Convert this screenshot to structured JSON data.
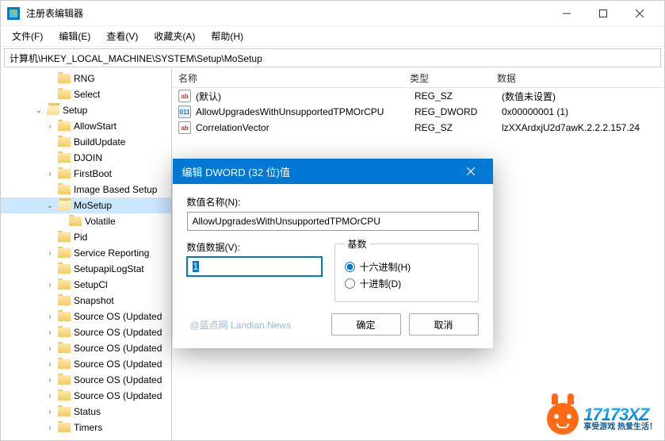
{
  "window": {
    "title": "注册表编辑器"
  },
  "menu": {
    "file": "文件(F)",
    "edit": "编辑(E)",
    "view": "查看(V)",
    "favorites": "收藏夹(A)",
    "help": "帮助(H)"
  },
  "address": "计算机\\HKEY_LOCAL_MACHINE\\SYSTEM\\Setup\\MoSetup",
  "tree": {
    "items": [
      {
        "indent": 4,
        "twisty": "",
        "open": false,
        "label": "RNG"
      },
      {
        "indent": 4,
        "twisty": "",
        "open": false,
        "label": "Select"
      },
      {
        "indent": 3,
        "twisty": "v",
        "open": true,
        "label": "Setup"
      },
      {
        "indent": 4,
        "twisty": ">",
        "open": false,
        "label": "AllowStart"
      },
      {
        "indent": 4,
        "twisty": "",
        "open": false,
        "label": "BuildUpdate"
      },
      {
        "indent": 4,
        "twisty": "",
        "open": false,
        "label": "DJOIN"
      },
      {
        "indent": 4,
        "twisty": ">",
        "open": false,
        "label": "FirstBoot"
      },
      {
        "indent": 4,
        "twisty": "",
        "open": false,
        "label": "Image Based Setup"
      },
      {
        "indent": 4,
        "twisty": "v",
        "open": true,
        "label": "MoSetup",
        "selected": true
      },
      {
        "indent": 5,
        "twisty": "",
        "open": false,
        "label": "Volatile"
      },
      {
        "indent": 4,
        "twisty": "",
        "open": false,
        "label": "Pid"
      },
      {
        "indent": 4,
        "twisty": ">",
        "open": false,
        "label": "Service Reporting"
      },
      {
        "indent": 4,
        "twisty": "",
        "open": false,
        "label": "SetupapiLogStat"
      },
      {
        "indent": 4,
        "twisty": ">",
        "open": false,
        "label": "SetupCl"
      },
      {
        "indent": 4,
        "twisty": "",
        "open": false,
        "label": "Snapshot"
      },
      {
        "indent": 4,
        "twisty": ">",
        "open": false,
        "label": "Source OS (Updated"
      },
      {
        "indent": 4,
        "twisty": ">",
        "open": false,
        "label": "Source OS (Updated"
      },
      {
        "indent": 4,
        "twisty": ">",
        "open": false,
        "label": "Source OS (Updated"
      },
      {
        "indent": 4,
        "twisty": ">",
        "open": false,
        "label": "Source OS (Updated"
      },
      {
        "indent": 4,
        "twisty": ">",
        "open": false,
        "label": "Source OS (Updated"
      },
      {
        "indent": 4,
        "twisty": ">",
        "open": false,
        "label": "Source OS (Updated"
      },
      {
        "indent": 4,
        "twisty": ">",
        "open": false,
        "label": "Status"
      },
      {
        "indent": 4,
        "twisty": ">",
        "open": false,
        "label": "Timers"
      }
    ]
  },
  "list": {
    "header": {
      "name": "名称",
      "type": "类型",
      "data": "数据"
    },
    "rows": [
      {
        "icon": "sz",
        "iconText": "ab",
        "name": "(默认)",
        "type": "REG_SZ",
        "data": "(数值未设置)"
      },
      {
        "icon": "dw",
        "iconText": "011",
        "name": "AllowUpgradesWithUnsupportedTPMOrCPU",
        "type": "REG_DWORD",
        "data": "0x00000001 (1)"
      },
      {
        "icon": "sz",
        "iconText": "ab",
        "name": "CorrelationVector",
        "type": "REG_SZ",
        "data": "lzXXArdxjU2d7awK.2.2.2.157.24"
      }
    ]
  },
  "dialog": {
    "title": "编辑 DWORD (32 位)值",
    "nameLabel": "数值名称(N):",
    "nameValue": "AllowUpgradesWithUnsupportedTPMOrCPU",
    "dataLabel": "数值数据(V):",
    "dataValue": "1",
    "baseLegend": "基数",
    "hexLabel": "十六进制(H)",
    "decLabel": "十进制(D)",
    "watermark": "@蓝点网 Landian.News",
    "ok": "确定",
    "cancel": "取消"
  },
  "logo": {
    "main": "17173XZ",
    "sub": "享受游戏  热爱生活！"
  }
}
